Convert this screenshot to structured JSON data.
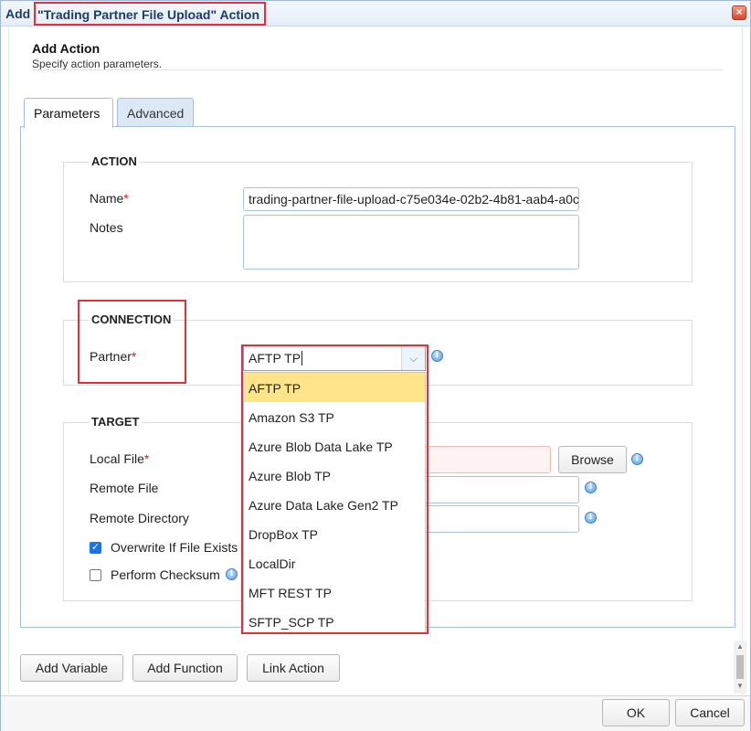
{
  "window": {
    "title_prefix": "Add",
    "title_highlight": "\"Trading Partner File Upload\" Action",
    "close_label": "×"
  },
  "header": {
    "title": "Add Action",
    "subtitle": "Specify action parameters."
  },
  "tabs": [
    {
      "label": "Parameters",
      "active": true
    },
    {
      "label": "Advanced",
      "active": false
    }
  ],
  "action": {
    "legend": "ACTION",
    "name_label": "Name",
    "name_value": "trading-partner-file-upload-c75e034e-02b2-4b81-aab4-a0c",
    "notes_label": "Notes",
    "notes_value": ""
  },
  "connection": {
    "legend": "CONNECTION",
    "partner_label": "Partner",
    "partner_value": "AFTP TP",
    "options": [
      "AFTP TP",
      "Amazon S3 TP",
      "Azure Blob Data Lake TP",
      "Azure Blob TP",
      "Azure Data Lake Gen2 TP",
      "DropBox TP",
      "LocalDir",
      "MFT REST TP",
      "SFTP_SCP TP"
    ],
    "selected_index": 0
  },
  "target": {
    "legend": "TARGET",
    "local_file_label": "Local File",
    "remote_file_label": "Remote File",
    "remote_directory_label": "Remote Directory",
    "overwrite_label": "Overwrite If File Exists",
    "overwrite_checked": true,
    "checksum_label": "Perform Checksum",
    "checksum_checked": false,
    "browse_label": "Browse"
  },
  "required_marker": "*",
  "bottom_buttons": {
    "add_variable": "Add Variable",
    "add_function": "Add Function",
    "link_action": "Link Action"
  },
  "footer": {
    "ok": "OK",
    "cancel": "Cancel"
  },
  "colors": {
    "highlight_border": "#e0303a",
    "selected_option": "#ffe48a",
    "checkbox_checked": "#1a73e8",
    "required": "#d42020"
  }
}
